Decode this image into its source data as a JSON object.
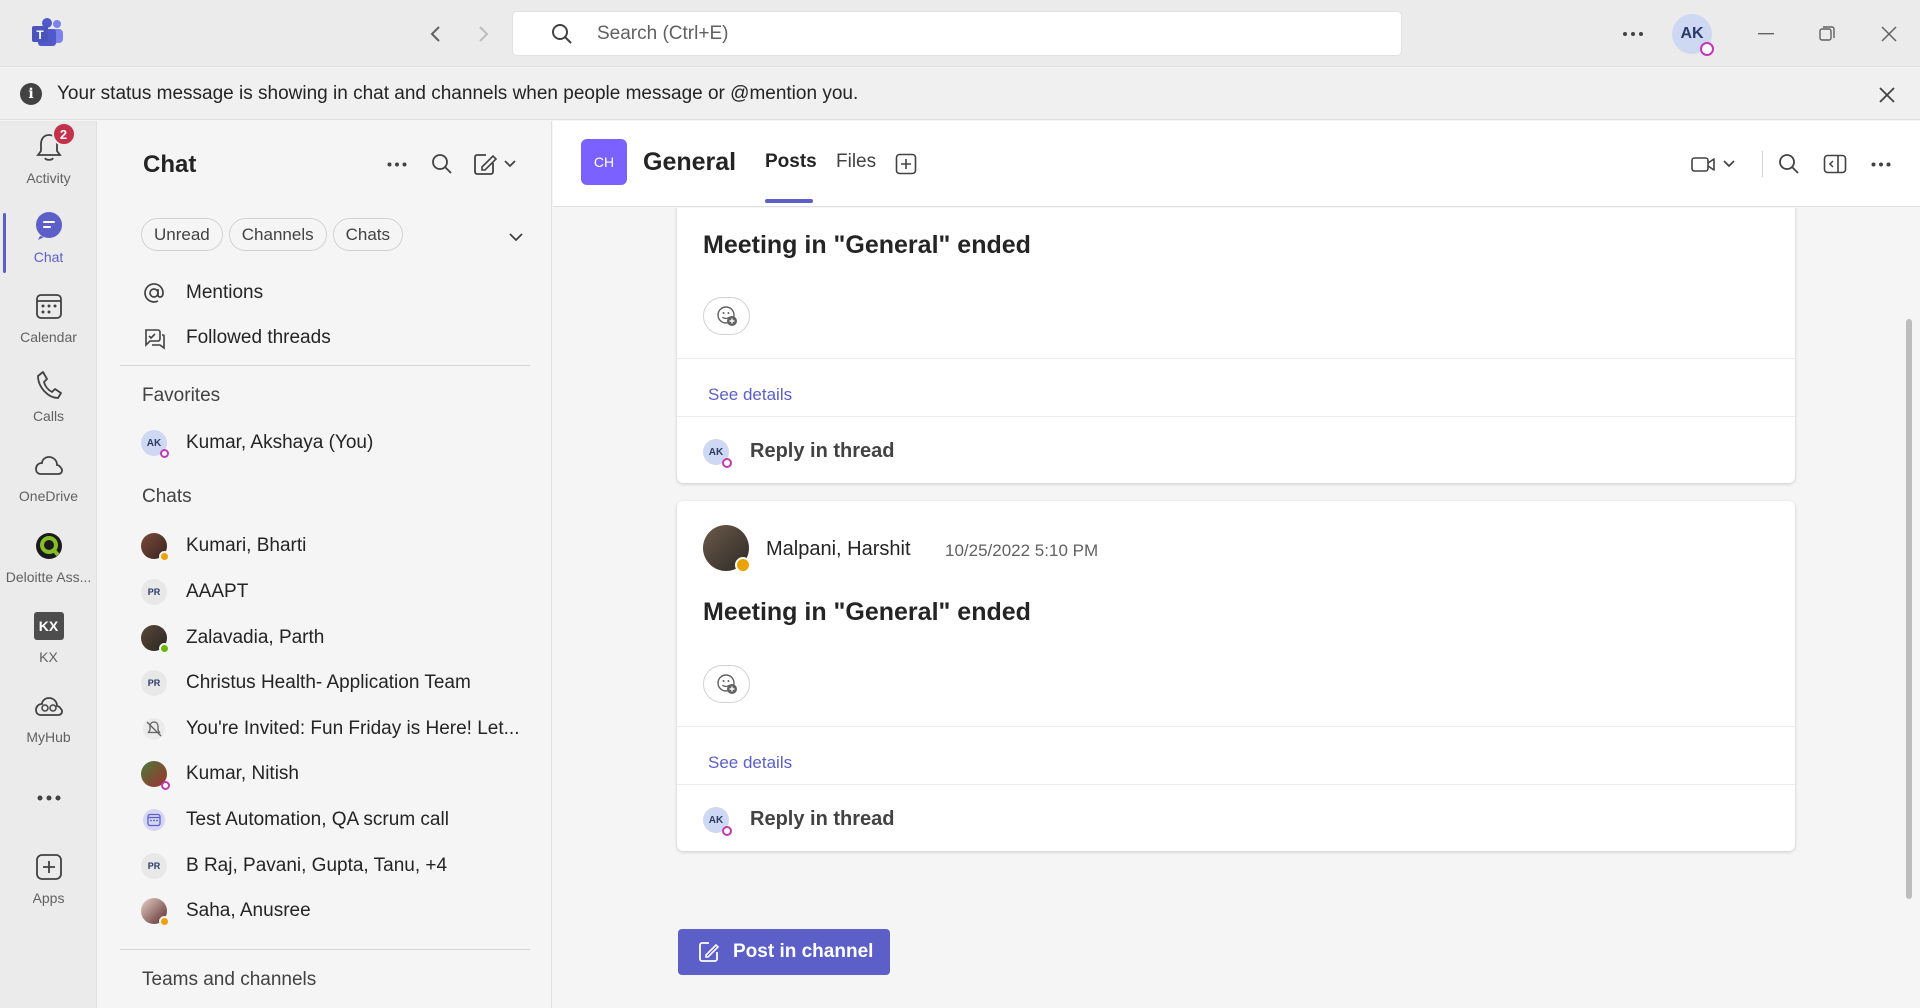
{
  "app": {
    "search_placeholder": "Search (Ctrl+E)",
    "user_initials": "AK",
    "accent_color": "#5b5fc7"
  },
  "banner": {
    "text": "Your status message is showing in chat and channels when people message or @mention you."
  },
  "rail": {
    "items": [
      {
        "label": "Activity",
        "icon": "bell-icon",
        "badge": "2"
      },
      {
        "label": "Chat",
        "icon": "chat-icon",
        "active": true
      },
      {
        "label": "Calendar",
        "icon": "calendar-icon"
      },
      {
        "label": "Calls",
        "icon": "phone-icon"
      },
      {
        "label": "OneDrive",
        "icon": "cloud-icon"
      },
      {
        "label": "Deloitte Ass...",
        "icon": "deloitte-assistant-icon"
      },
      {
        "label": "KX",
        "icon": "kx-icon",
        "tile_text": "KX"
      },
      {
        "label": "MyHub",
        "icon": "myhub-icon"
      },
      {
        "label": "Apps",
        "icon": "apps-icon"
      }
    ]
  },
  "chatpane": {
    "title": "Chat",
    "filters": [
      "Unread",
      "Channels",
      "Chats"
    ],
    "quick_links": [
      {
        "label": "Mentions",
        "icon": "at-icon"
      },
      {
        "label": "Followed threads",
        "icon": "followed-threads-icon"
      }
    ],
    "favorites_label": "Favorites",
    "favorites": [
      {
        "label": "Kumar, Akshaya (You)",
        "initials": "AK"
      }
    ],
    "chats_label": "Chats",
    "chats": [
      {
        "label": "Kumari, Bharti",
        "presence": "#eaa300"
      },
      {
        "label": "AAAPT",
        "initials": "PR"
      },
      {
        "label": "Zalavadia, Parth",
        "presence": "#6bb700"
      },
      {
        "label": "Christus Health- Application Team",
        "initials": "PR"
      },
      {
        "label": "You're Invited: Fun Friday is Here! Let...",
        "icon": "muted-bell-icon"
      },
      {
        "label": "Kumar, Nitish"
      },
      {
        "label": "Test Automation, QA scrum call",
        "icon": "meeting-calendar-icon"
      },
      {
        "label": "B Raj, Pavani, Gupta, Tanu, +4",
        "initials": "PR"
      },
      {
        "label": "Saha, Anusree",
        "presence": "#eaa300"
      }
    ],
    "teams_label": "Teams and channels"
  },
  "channel": {
    "avatar_text": "CH",
    "name": "General",
    "tabs": [
      "Posts",
      "Files"
    ],
    "posts": [
      {
        "title": "Meeting in \"General\" ended",
        "see_details": "See details",
        "reply_label": "Reply in thread",
        "reply_initials": "AK"
      },
      {
        "author": "Malpani, Harshit",
        "time": "10/25/2022 5:10 PM",
        "title": "Meeting in \"General\" ended",
        "see_details": "See details",
        "reply_label": "Reply in thread",
        "reply_initials": "AK"
      }
    ],
    "post_button": "Post in channel"
  }
}
